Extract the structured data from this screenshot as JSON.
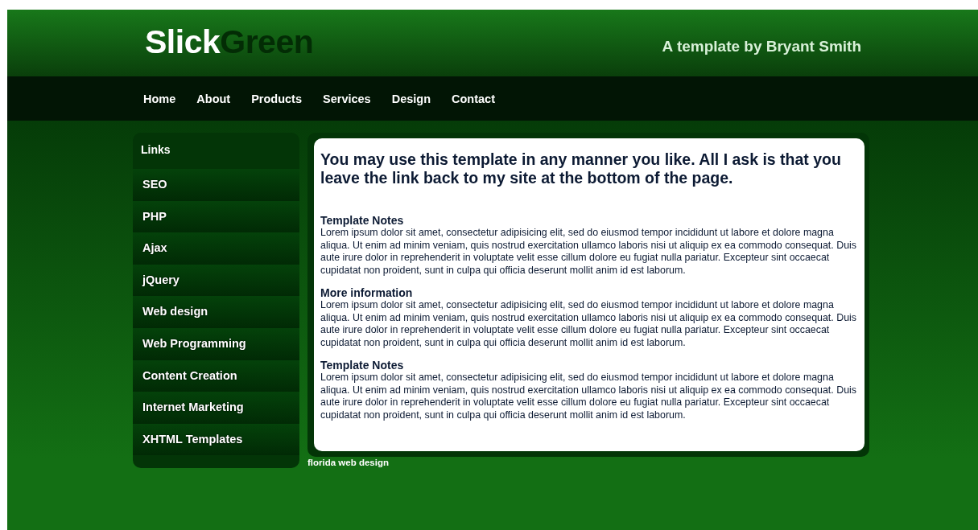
{
  "header": {
    "logo": {
      "part_1": "Slick",
      "part_2": "Green"
    },
    "tagline": "A template by Bryant Smith"
  },
  "nav": [
    {
      "label": "Home"
    },
    {
      "label": "About"
    },
    {
      "label": "Products"
    },
    {
      "label": "Services"
    },
    {
      "label": "Design"
    },
    {
      "label": "Contact"
    }
  ],
  "sidebar": {
    "title": "Links",
    "items": [
      {
        "label": "SEO"
      },
      {
        "label": "PHP"
      },
      {
        "label": "Ajax"
      },
      {
        "label": "jQuery"
      },
      {
        "label": "Web design"
      },
      {
        "label": "Web Programming"
      },
      {
        "label": "Content Creation"
      },
      {
        "label": "Internet Marketing"
      },
      {
        "label": "XHTML Templates"
      }
    ]
  },
  "content": {
    "heading": "You may use this template in any manner you like. All I ask is that you leave the link back to my site at the bottom of the page.",
    "sections": [
      {
        "title": "Template Notes",
        "text": "Lorem ipsum dolor sit amet, consectetur adipisicing elit, sed do eiusmod tempor incididunt ut labore et dolore magna aliqua. Ut enim ad minim veniam, quis nostrud exercitation ullamco laboris nisi ut aliquip ex ea commodo consequat. Duis aute irure dolor in reprehenderit in voluptate velit esse cillum dolore eu fugiat nulla pariatur. Excepteur sint occaecat cupidatat non proident, sunt in culpa qui officia deserunt mollit anim id est laborum."
      },
      {
        "title": "More information",
        "text": "Lorem ipsum dolor sit amet, consectetur adipisicing elit, sed do eiusmod tempor incididunt ut labore et dolore magna aliqua. Ut enim ad minim veniam, quis nostrud exercitation ullamco laboris nisi ut aliquip ex ea commodo consequat. Duis aute irure dolor in reprehenderit in voluptate velit esse cillum dolore eu fugiat nulla pariatur. Excepteur sint occaecat cupidatat non proident, sunt in culpa qui officia deserunt mollit anim id est laborum."
      },
      {
        "title": "Template Notes",
        "text": "Lorem ipsum dolor sit amet, consectetur adipisicing elit, sed do eiusmod tempor incididunt ut labore et dolore magna aliqua. Ut enim ad minim veniam, quis nostrud exercitation ullamco laboris nisi ut aliquip ex ea commodo consequat. Duis aute irure dolor in reprehenderit in voluptate velit esse cillum dolore eu fugiat nulla pariatur. Excepteur sint occaecat cupidatat non proident, sunt in culpa qui officia deserunt mollit anim id est laborum."
      }
    ]
  },
  "footer": {
    "link": "florida web design"
  }
}
